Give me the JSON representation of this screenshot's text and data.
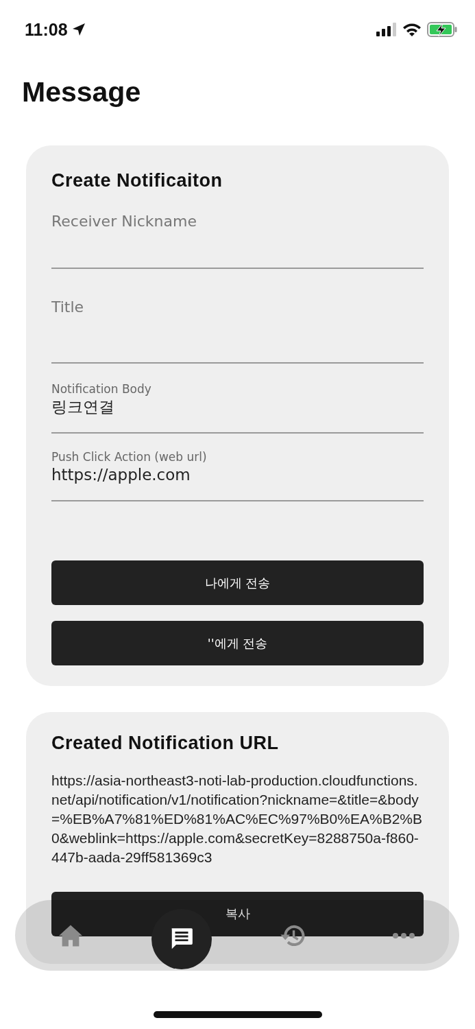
{
  "status_bar": {
    "time": "11:08"
  },
  "page_title": "Message",
  "create_card": {
    "title": "Create Notificaiton",
    "fields": [
      {
        "placeholder": "Receiver Nickname"
      },
      {
        "placeholder": "Title"
      },
      {
        "label": "Notification Body",
        "value": "링크연결"
      },
      {
        "label": "Push Click Action (web url)",
        "value": "https://apple.com"
      }
    ],
    "buttons": [
      "나에게 전송",
      "''에게 전송"
    ]
  },
  "url_card": {
    "title": "Created Notification URL",
    "url": "https://asia-northeast3-noti-lab-production.cloudfunctions.net/api/notification/v1/notification?nickname=&title=&body=%EB%A7%81%ED%81%AC%EC%97%B0%EA%B2%B0&weblink=https://apple.com&secretKey=8288750a-f860-447b-aada-29ff581369c3",
    "button": "복사"
  },
  "tab_bar": [
    {
      "kind": "home",
      "selected": false
    },
    {
      "kind": "message",
      "selected": true
    },
    {
      "kind": "history",
      "selected": false
    },
    {
      "kind": "more",
      "selected": false
    }
  ]
}
